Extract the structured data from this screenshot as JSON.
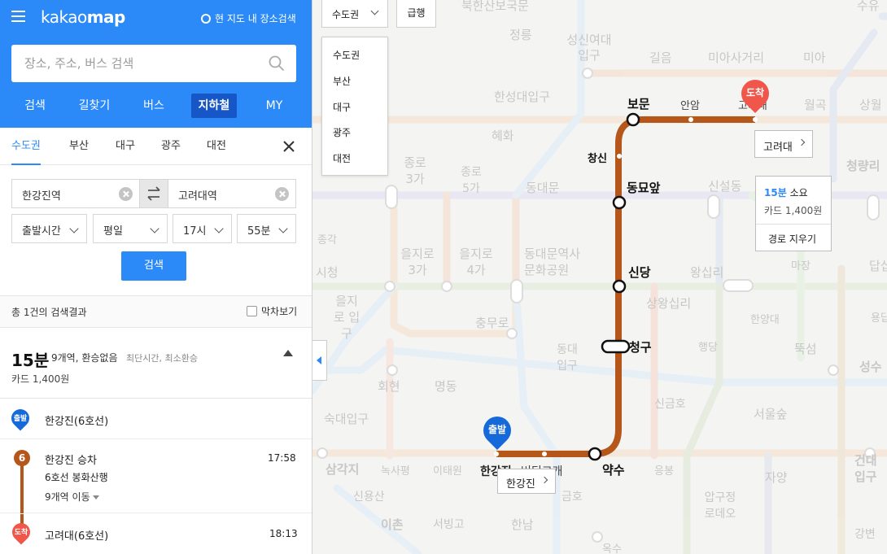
{
  "sidebar": {
    "logo_a": "kakao",
    "logo_b": "map",
    "map_search_label": "현 지도 내 장소검색",
    "search_placeholder": "장소, 주소, 버스 검색",
    "main_tabs": [
      "검색",
      "길찾기",
      "버스",
      "지하철",
      "MY"
    ],
    "region_tabs": [
      "수도권",
      "부산",
      "대구",
      "광주",
      "대전"
    ],
    "origin": "한강진역",
    "destination": "고려대역",
    "time_mode": "출발시간",
    "day": "평일",
    "hour": "17시",
    "minute": "55분",
    "search_button": "검색",
    "result_count": "총 1건의 검색결과",
    "last_train": "막차보기",
    "route": {
      "minutes": "15분",
      "stops_info": "9개역, 환승없음",
      "tags": "최단시간, 최소환승",
      "fare": "카드 1,400원"
    },
    "steps": {
      "start_badge": "출발",
      "start_station": "한강진(6호선)",
      "line_number": "6",
      "board_label": "한강진 승차",
      "board_time": "17:58",
      "direction": "6호선 봉화산행",
      "moves": "9개역 이동",
      "end_badge": "도착",
      "end_station": "고려대(6호선)",
      "end_time": "18:13"
    }
  },
  "map": {
    "region_select": "수도권",
    "express_button": "급행",
    "region_options": [
      "수도권",
      "부산",
      "대구",
      "광주",
      "대전"
    ],
    "start_pin": "출발",
    "end_pin": "도착",
    "start_tag": "한강진",
    "end_tag": "고려대",
    "info_minutes": "15분",
    "info_suffix": "소요",
    "info_fare": "카드 1,400원",
    "info_clear": "경로 지우기",
    "route_stations": [
      "보문",
      "안암",
      "고려대",
      "창신",
      "동묘앞",
      "신당",
      "청구",
      "약수",
      "한강진",
      "버티고개"
    ],
    "background_labels": [
      "북한산보국문",
      "수유",
      "정릉",
      "성신여대 입구",
      "길음",
      "미아사거리",
      "미아",
      "한성대입구",
      "월곡",
      "상월",
      "혜화",
      "종로 3가",
      "종로 5가",
      "동대문",
      "신설동",
      "청량리",
      "종각",
      "을지로 3가",
      "을지로 4가",
      "동대문역사 문화공원",
      "왕십리",
      "마장",
      "답십",
      "시청",
      "을지로 입구",
      "상왕십리",
      "한양대",
      "용답",
      "충무로",
      "동대 입구",
      "행당",
      "뚝섬",
      "성수",
      "회현",
      "명동",
      "신금호",
      "숙대입구",
      "서울숲",
      "삼각지",
      "녹사평",
      "이태원",
      "응봉",
      "건대입구",
      "신용산",
      "자양",
      "이촌",
      "서빙고",
      "한남",
      "금호",
      "압구정 로데오",
      "옥수",
      "강변"
    ],
    "colors": {
      "line6": "#b5561a",
      "accent": "#2b8af7",
      "end_pin": "#f0564a"
    }
  }
}
